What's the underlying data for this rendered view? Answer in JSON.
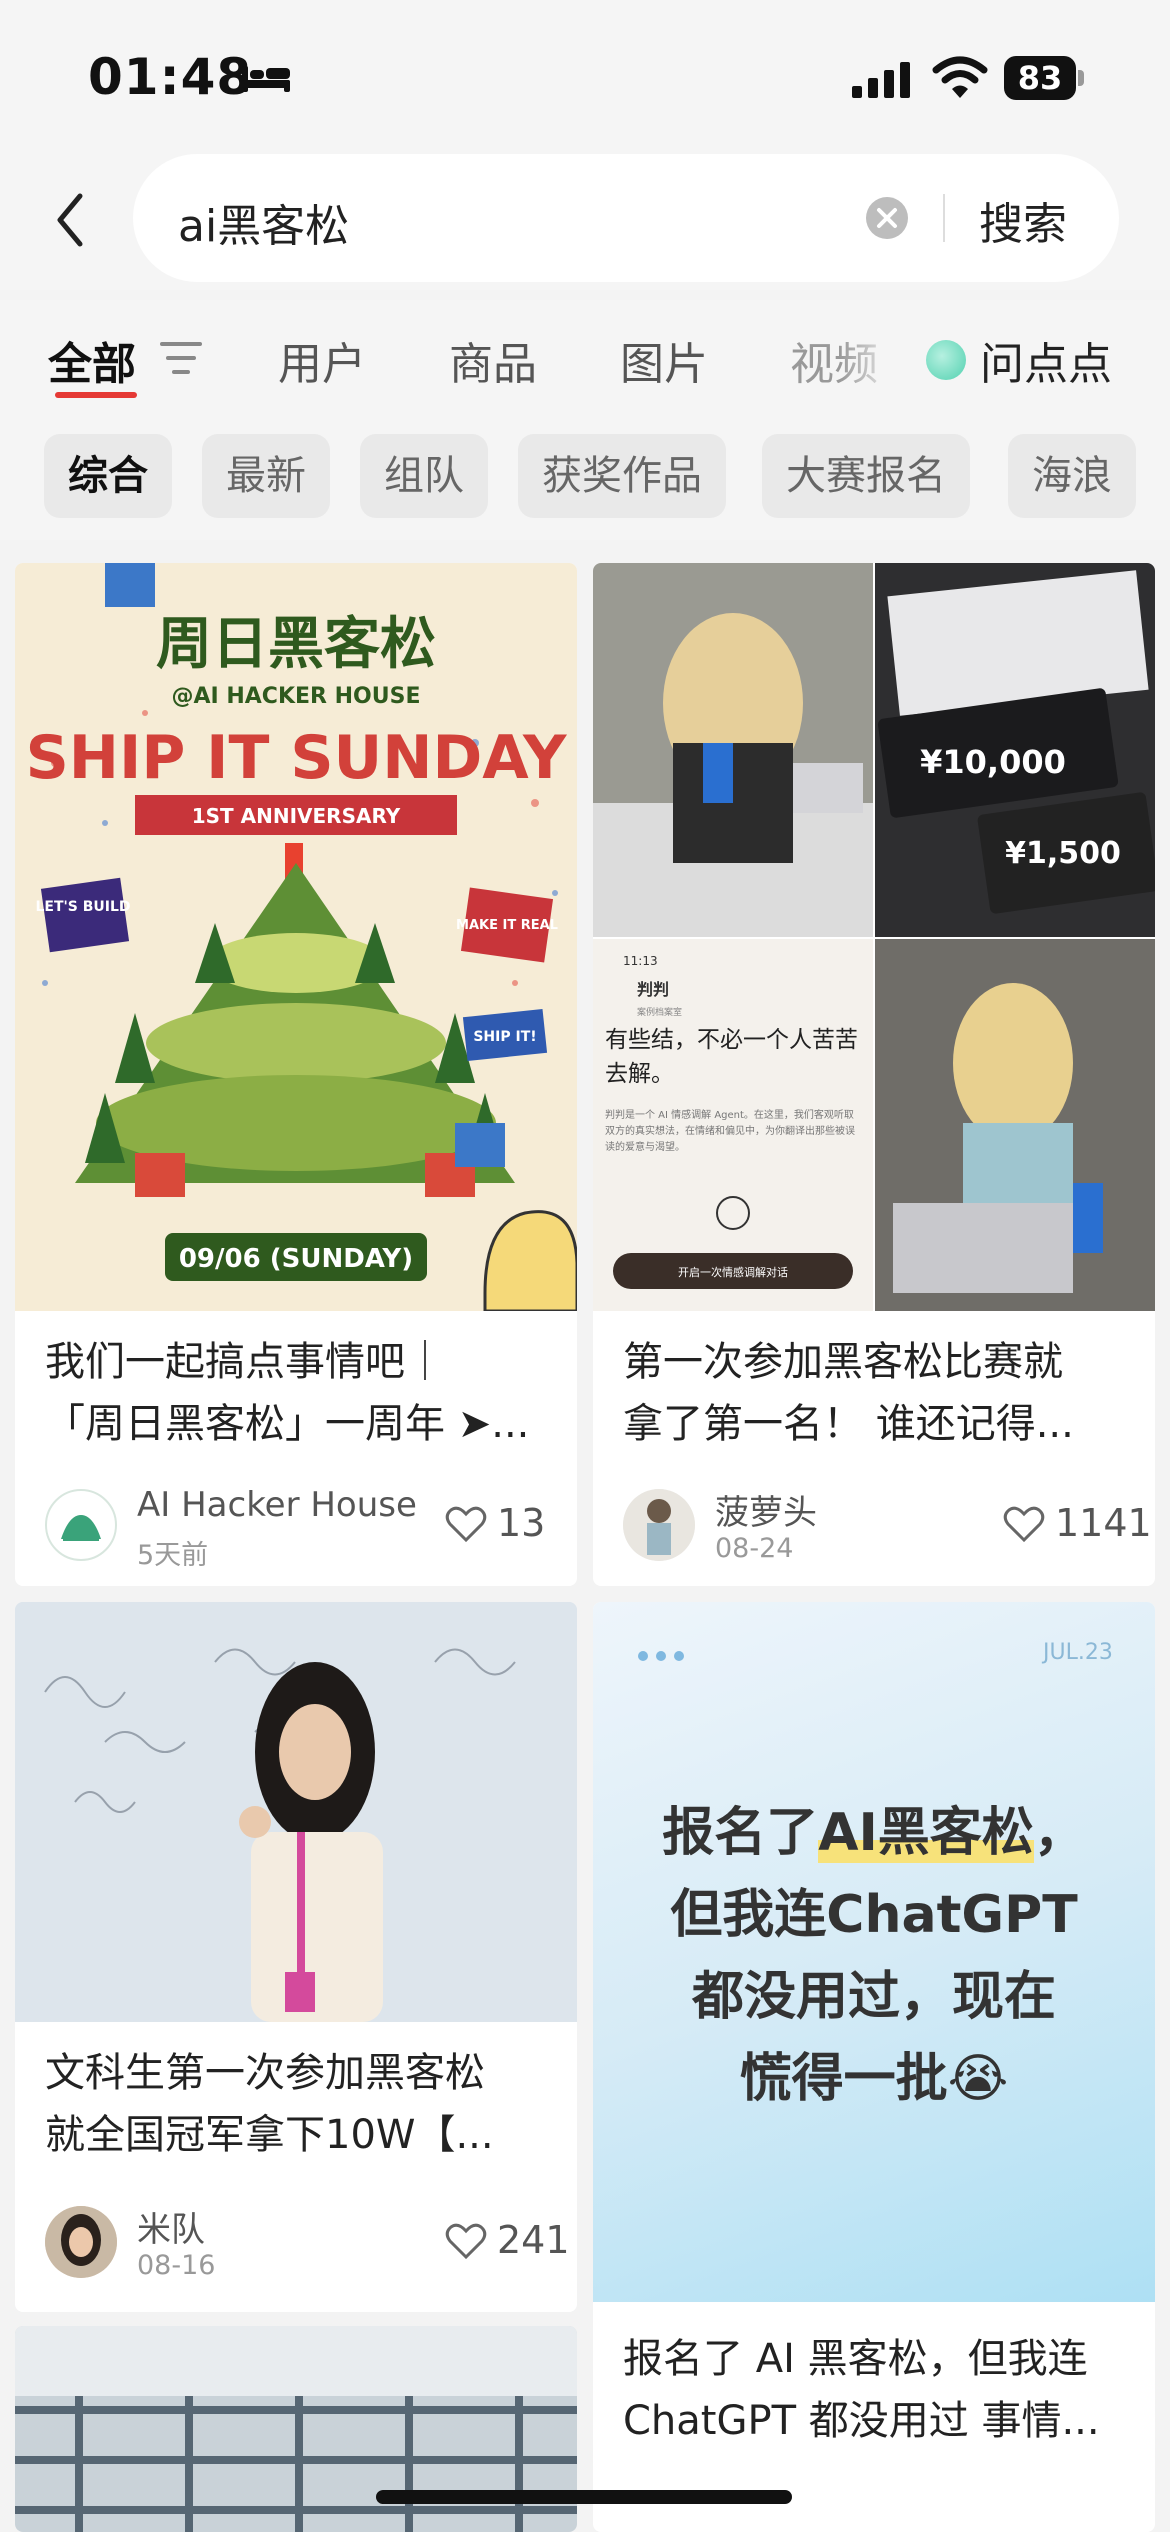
{
  "status_bar": {
    "time": "01:48",
    "battery": "83"
  },
  "search": {
    "query": "ai黑客松",
    "button_label": "搜索"
  },
  "tabs": [
    {
      "label": "全部"
    },
    {
      "label": "用户"
    },
    {
      "label": "商品"
    },
    {
      "label": "图片"
    },
    {
      "label": "视频"
    },
    {
      "label": "问点点"
    }
  ],
  "chips": [
    "综合",
    "最新",
    "组队",
    "获奖作品",
    "大赛报名",
    "海浪"
  ],
  "posts": [
    {
      "poster": {
        "heading": "周日黑客松",
        "host": "@AI HACKER HOUSE",
        "headline": "SHIP IT SUNDAY",
        "ribbon": "1ST ANNIVERSARY",
        "sign_left": "LET'S BUILD",
        "sign_right": "MAKE IT REAL",
        "sign_ship": "SHIP IT!",
        "date": "09/06 (SUNDAY)"
      },
      "title_line1": "我们一起搞点事情吧｜",
      "title_line2": "「周日黑客松」一周年 ➤...",
      "author": "AI Hacker House",
      "date": "5天前",
      "likes": "13"
    },
    {
      "collage": {
        "prize_big": "¥10,000",
        "prize_small": "¥1,500",
        "app_time": "11:13",
        "app_name": "判判",
        "app_subtitle": "案例档案室",
        "app_headline": "有些结，不必一个人苦苦去解。",
        "app_body": "判判是一个 AI 情感调解 Agent。在这里，我们客观听取双方的真实想法，在情绪和偏见中，为你翻译出那些被误读的爱意与渴望。",
        "app_button": "开启一次情感调解对话"
      },
      "title_line1": "第一次参加黑客松比赛就",
      "title_line2": "拿了第一名！ 谁还记得...",
      "author": "菠萝头",
      "date": "08-24",
      "likes": "1141"
    },
    {
      "title_line1": "文科生第一次参加黑客松",
      "title_line2": "就全国冠军拿下10W【...",
      "author": "米队",
      "date": "08-16",
      "likes": "241"
    },
    {
      "cover": {
        "date_tag": "JUL.23",
        "line1_a": "报名了",
        "line1_b": "AI黑客松",
        "line1_c": "，",
        "line2": "但我连ChatGPT",
        "line3": "都没用过，现在",
        "line4": "慌得一批😭"
      },
      "title_line1": "报名了 AI 黑客松，但我连",
      "title_line2": "ChatGPT 都没用过 事情..."
    }
  ]
}
